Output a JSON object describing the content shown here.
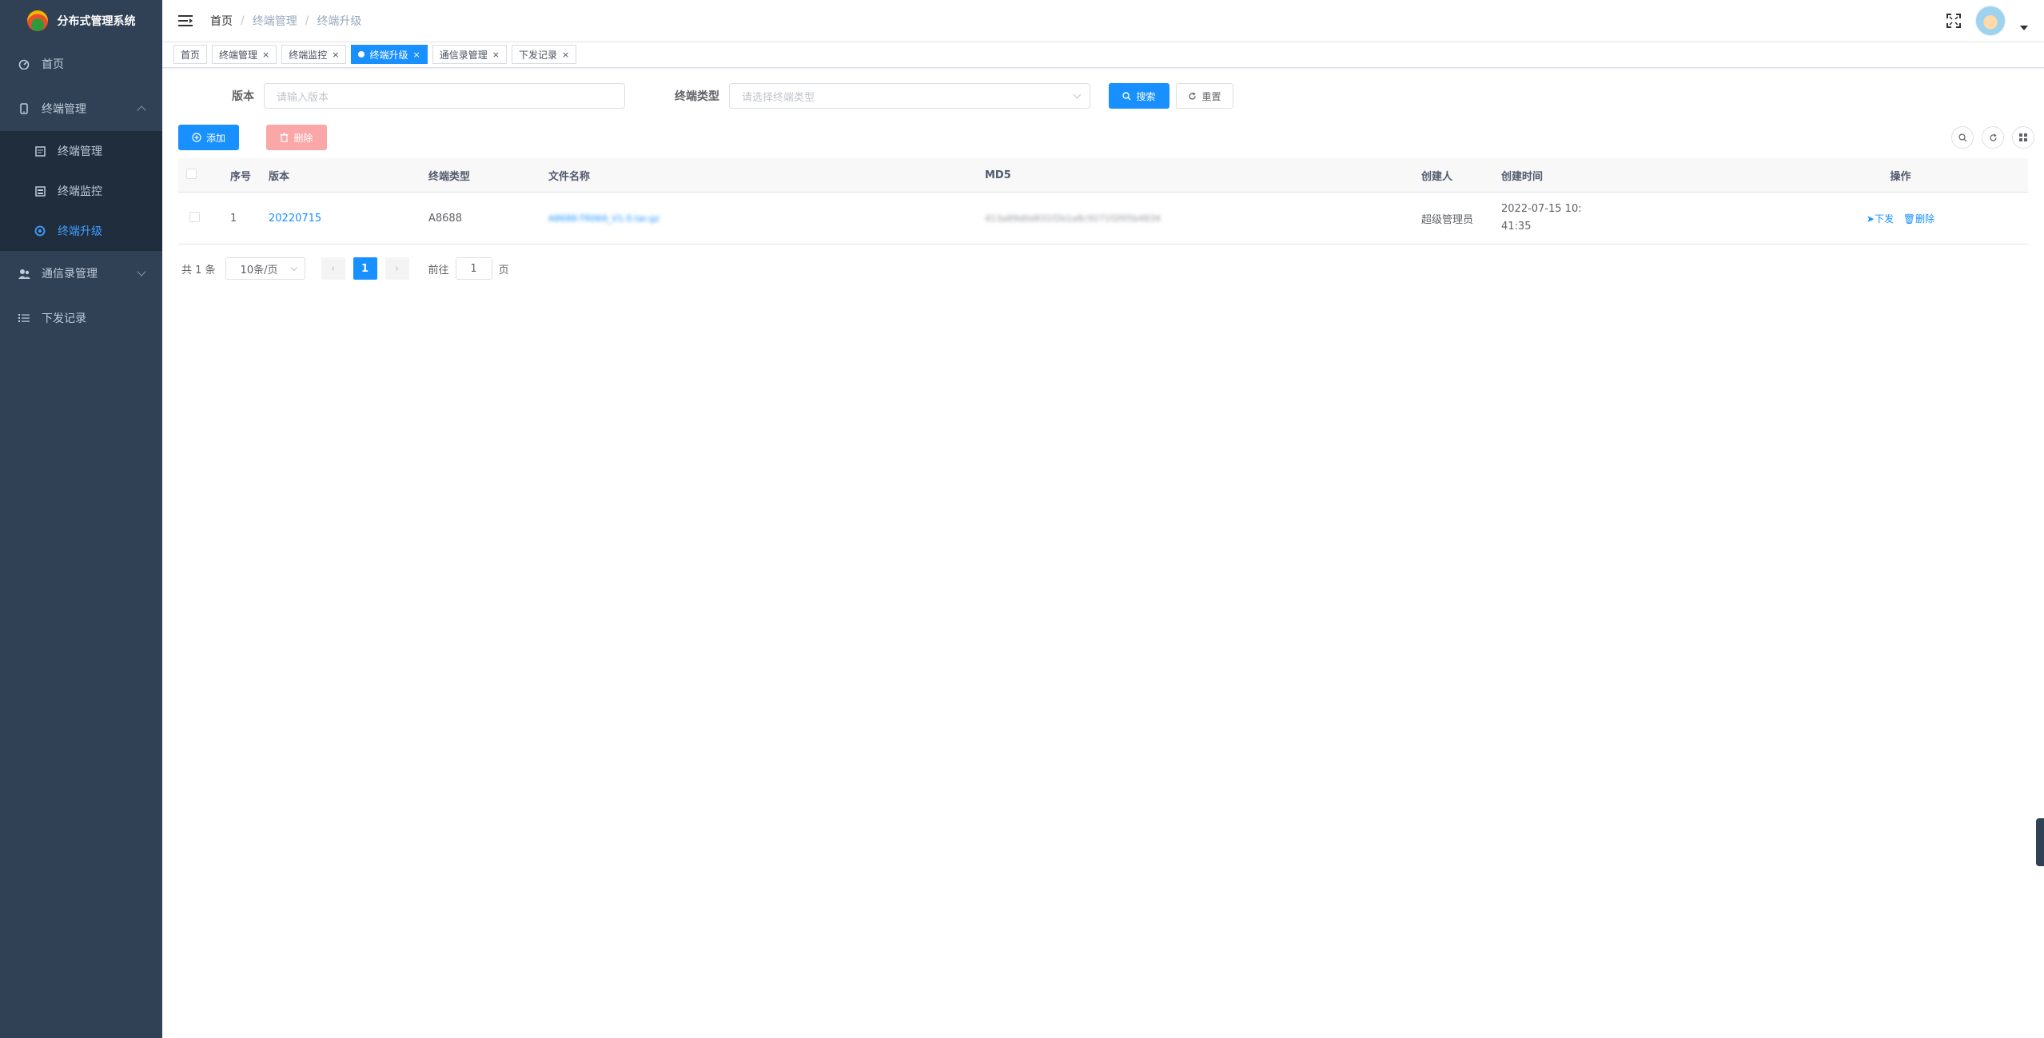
{
  "app": {
    "title": "分布式管理系统"
  },
  "sidebar": {
    "items": [
      {
        "label": "首页",
        "icon": "dashboard-icon"
      },
      {
        "label": "终端管理",
        "icon": "phone-icon",
        "expanded": true,
        "children": [
          {
            "label": "终端管理",
            "icon": "doc-icon"
          },
          {
            "label": "终端监控",
            "icon": "monitor-icon"
          },
          {
            "label": "终端升级",
            "icon": "upgrade-icon",
            "active": true
          }
        ]
      },
      {
        "label": "通信录管理",
        "icon": "users-icon",
        "expanded": false
      },
      {
        "label": "下发记录",
        "icon": "list-icon"
      }
    ]
  },
  "breadcrumb": [
    "首页",
    "终端管理",
    "终端升级"
  ],
  "tags": [
    {
      "label": "首页",
      "closable": false,
      "active": false
    },
    {
      "label": "终端管理",
      "closable": true,
      "active": false
    },
    {
      "label": "终端监控",
      "closable": true,
      "active": false
    },
    {
      "label": "终端升级",
      "closable": true,
      "active": true
    },
    {
      "label": "通信录管理",
      "closable": true,
      "active": false
    },
    {
      "label": "下发记录",
      "closable": true,
      "active": false
    }
  ],
  "search": {
    "version_label": "版本",
    "version_placeholder": "请输入版本",
    "type_label": "终端类型",
    "type_placeholder": "请选择终端类型",
    "search_btn": "搜索",
    "reset_btn": "重置"
  },
  "toolbar": {
    "add_btn": "添加",
    "delete_btn": "删除"
  },
  "table": {
    "columns": [
      "序号",
      "版本",
      "终端类型",
      "文件名称",
      "MD5",
      "创建人",
      "创建时间",
      "操作"
    ],
    "rows": [
      {
        "index": "1",
        "version": "20220715",
        "type": "A8688",
        "filename": "A8688-TR069_V1.0.tar.gz",
        "md5": "413a89d0d831f2b1a8c9271f2f05b4834",
        "creator": "超级管理员",
        "created_line1": "2022-07-15 10:",
        "created_line2": "41:35",
        "action_send": "下发",
        "action_delete": "删除"
      }
    ]
  },
  "pagination": {
    "total_text": "共 1 条",
    "page_size": "10条/页",
    "current_page": "1",
    "goto_label": "前往",
    "goto_value": "1",
    "page_suffix": "页"
  },
  "colors": {
    "sidebar": "#304156",
    "submenu": "#1f2d3d",
    "primary": "#1890ff",
    "danger_disabled": "#f9a7a7"
  }
}
